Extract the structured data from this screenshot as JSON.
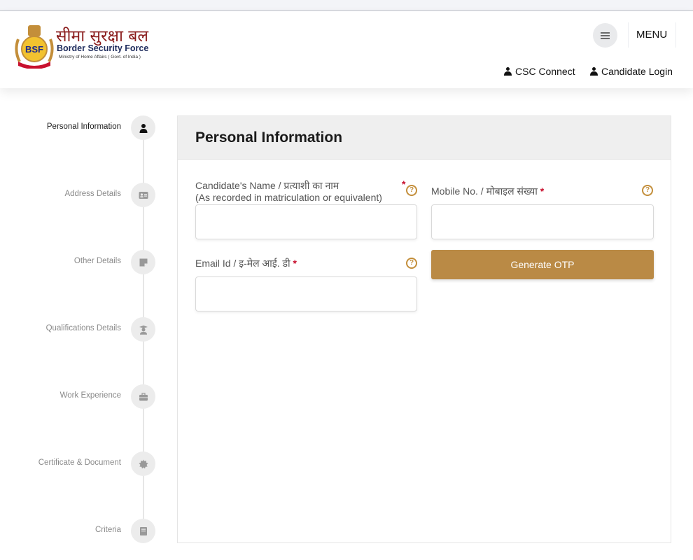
{
  "brand": {
    "hindi_name": "सीमा सुरक्षा बल",
    "english_name": "Border Security Force",
    "sub": "Ministry of Home Affairs ( Govt. of India )",
    "emblem_text": "BSF"
  },
  "header": {
    "menu_label": "MENU",
    "csc_connect": "CSC Connect",
    "candidate_login": "Candidate Login"
  },
  "steps": [
    {
      "label": "Personal Information",
      "icon": "user-icon",
      "active": true
    },
    {
      "label": "Address Details",
      "icon": "id-card-icon"
    },
    {
      "label": "Other Details",
      "icon": "note-icon"
    },
    {
      "label": "Qualifications Details",
      "icon": "graduate-icon"
    },
    {
      "label": "Work Experience",
      "icon": "briefcase-icon"
    },
    {
      "label": "Certificate & Document",
      "icon": "certificate-icon"
    },
    {
      "label": "Criteria",
      "icon": "book-icon"
    }
  ],
  "form": {
    "title": "Personal Information",
    "name_label_1": "Candidate's Name / प्रत्याशी का नाम",
    "name_label_2": "(As recorded in matriculation or equivalent)",
    "mobile_label": "Mobile No. / मोबाइल संख्या",
    "email_label": "Email Id / इ-मेल आई. डी",
    "required_mark": "*",
    "help_glyph": "?",
    "generate_otp": "Generate OTP",
    "name_value": "",
    "mobile_value": "",
    "email_value": ""
  },
  "colors": {
    "accent": "#ba8a45",
    "required": "#c8102e",
    "help": "#c38e3a"
  }
}
